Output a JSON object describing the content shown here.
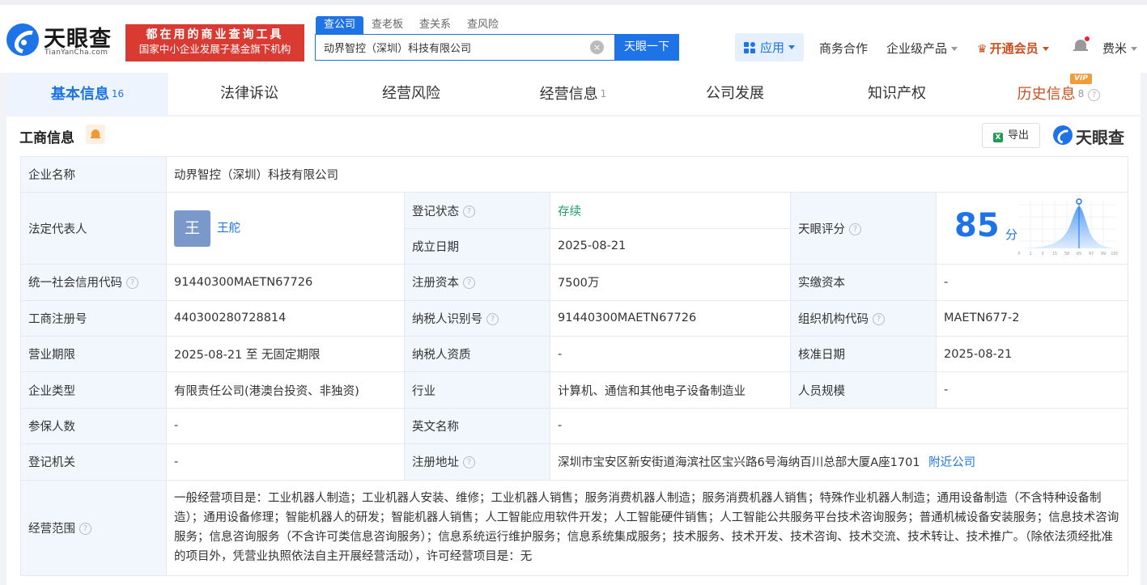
{
  "header": {
    "logo_cn": "天眼查",
    "logo_en": "TianYanCha.com",
    "slogan_line1": "都在用的商业查询工具",
    "slogan_line2": "国家中小企业发展子基金旗下机构",
    "search_tabs": [
      "查公司",
      "查老板",
      "查关系",
      "查风险"
    ],
    "search_value": "动界智控（深圳）科技有限公司",
    "search_button": "天眼一下",
    "clear_glyph": "×",
    "nav_apps": "应用",
    "nav_business": "商务合作",
    "nav_enterprise": "企业级产品",
    "nav_vip": "开通会员",
    "username": "费米"
  },
  "tabs": [
    {
      "label": "基本信息",
      "count": "16"
    },
    {
      "label": "法律诉讼",
      "count": ""
    },
    {
      "label": "经营风险",
      "count": ""
    },
    {
      "label": "经营信息",
      "count": "1"
    },
    {
      "label": "公司发展",
      "count": ""
    },
    {
      "label": "知识产权",
      "count": ""
    },
    {
      "label": "历史信息",
      "count": "8",
      "badge": "VIP"
    }
  ],
  "section": {
    "title": "工商信息",
    "export_label": "导出",
    "watermark": "天眼查"
  },
  "info": {
    "company_name_label": "企业名称",
    "company_name": "动界智控（深圳）科技有限公司",
    "legal_rep_label": "法定代表人",
    "legal_rep_avatar": "王",
    "legal_rep_name": "王舵",
    "reg_status_label": "登记状态",
    "reg_status": "存续",
    "found_date_label": "成立日期",
    "found_date": "2025-08-21",
    "score_label": "天眼评分",
    "score": "85",
    "score_unit": "分",
    "score_axis": [
      "0",
      "1",
      "3",
      "15",
      "58",
      "65",
      "97",
      "99",
      "100"
    ],
    "credit_code_label": "统一社会信用代码",
    "credit_code": "91440300MAETN67726",
    "reg_capital_label": "注册资本",
    "reg_capital": "7500万",
    "paid_capital_label": "实缴资本",
    "paid_capital": "-",
    "biz_reg_no_label": "工商注册号",
    "biz_reg_no": "440300280728814",
    "taxpayer_id_label": "纳税人识别号",
    "taxpayer_id": "91440300MAETN67726",
    "org_code_label": "组织机构代码",
    "org_code": "MAETN677-2",
    "term_label": "营业期限",
    "term": "2025-08-21 至 无固定期限",
    "taxpayer_qual_label": "纳税人资质",
    "taxpayer_qual": "-",
    "approve_date_label": "核准日期",
    "approve_date": "2025-08-21",
    "company_type_label": "企业类型",
    "company_type": "有限责任公司(港澳台投资、非独资)",
    "industry_label": "行业",
    "industry": "计算机、通信和其他电子设备制造业",
    "staff_size_label": "人员规模",
    "staff_size": "-",
    "insured_label": "参保人数",
    "insured": "-",
    "en_name_label": "英文名称",
    "en_name": "-",
    "reg_authority_label": "登记机关",
    "reg_authority": "-",
    "reg_address_label": "注册地址",
    "reg_address": "深圳市宝安区新安街道海滨社区宝兴路6号海纳百川总部大厦A座1701",
    "nearby_link": "附近公司",
    "scope_label": "经营范围",
    "scope": "一般经营项目是：工业机器人制造；工业机器人安装、维修；工业机器人销售；服务消费机器人制造；服务消费机器人销售；特殊作业机器人制造；通用设备制造（不含特种设备制造）；通用设备修理；智能机器人的研发；智能机器人销售；人工智能应用软件开发；人工智能硬件销售；人工智能公共服务平台技术咨询服务；普通机械设备安装服务；信息技术咨询服务；信息咨询服务（不含许可类信息咨询服务）；信息系统运行维护服务；信息系统集成服务；技术服务、技术开发、技术咨询、技术交流、技术转让、技术推广。（除依法须经批准的项目外，凭营业执照依法自主开展经营活动），许可经营项目是：无"
  },
  "colors": {
    "brand_blue": "#1e74e6",
    "slogan_red": "#d93a32",
    "status_green": "#1fa06a",
    "vip_orange": "#c7501e"
  }
}
